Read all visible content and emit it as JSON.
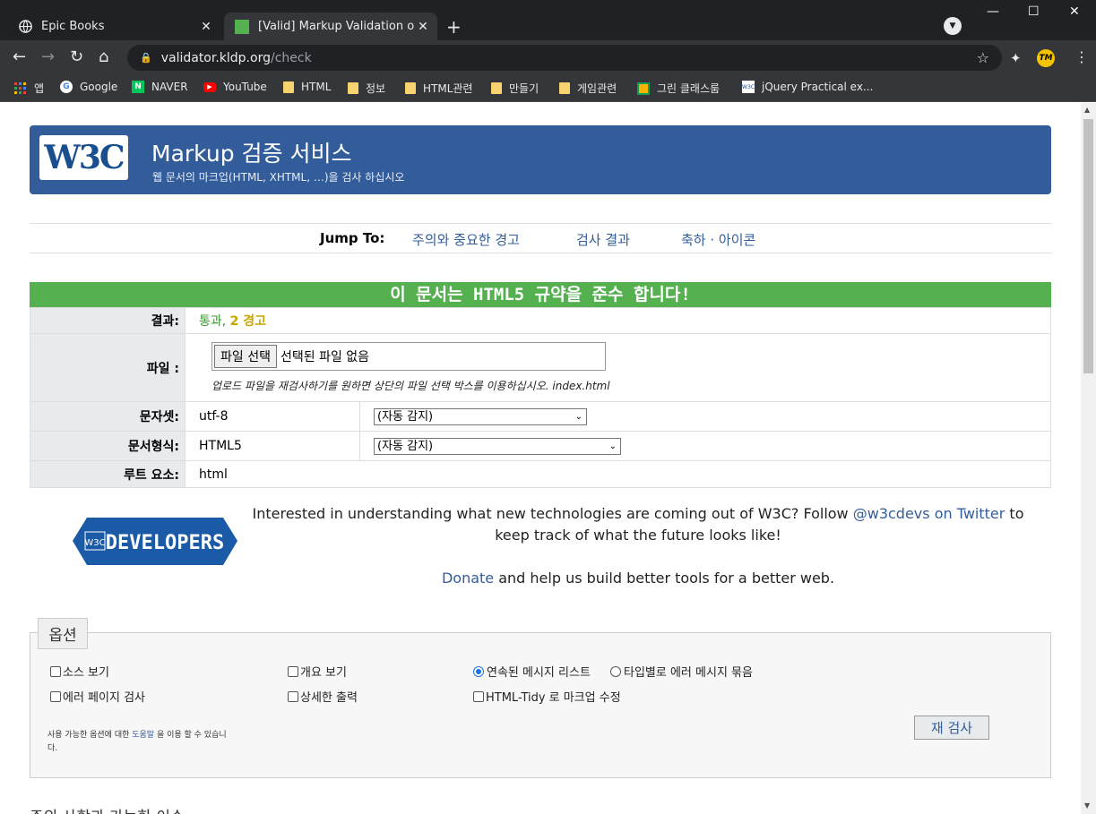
{
  "browser": {
    "tabs": [
      {
        "title": "Epic Books",
        "active": false
      },
      {
        "title": "[Valid] Markup Validation of ind",
        "active": true
      }
    ],
    "url_host": "validator.kldp.org",
    "url_path": "/check",
    "bookmarks": [
      {
        "label": "앱",
        "icon": "apps-grid-icon"
      },
      {
        "label": "Google",
        "icon": "google-icon"
      },
      {
        "label": "NAVER",
        "icon": "naver-icon"
      },
      {
        "label": "YouTube",
        "icon": "youtube-icon"
      },
      {
        "label": "HTML",
        "icon": "folder-icon"
      },
      {
        "label": "정보",
        "icon": "folder-icon"
      },
      {
        "label": "HTML관련",
        "icon": "folder-icon"
      },
      {
        "label": "만들기",
        "icon": "folder-icon"
      },
      {
        "label": "게임관련",
        "icon": "folder-icon"
      },
      {
        "label": "그린 클래스룸",
        "icon": "classroom-icon"
      },
      {
        "label": "jQuery Practical ex...",
        "icon": "w3c-icon"
      }
    ]
  },
  "banner": {
    "logo_text": "W3C",
    "title": "Markup 검증 서비스",
    "subtitle": "웹 문서의 마크업(HTML, XHTML, …)을 검사 하십시오"
  },
  "jump": {
    "label": "Jump To:",
    "links": [
      "주의와 중요한 경고",
      "검사 결과",
      "축하 · 아이콘"
    ]
  },
  "result": {
    "header": "이 문서는 HTML5 규약을 준수 합니다!",
    "rows": {
      "result_label": "결과:",
      "result_pass": "통과,",
      "result_warn": "2 경고",
      "file_label": "파일 :",
      "file_button": "파일 선택",
      "file_none": "선택된 파일 없음",
      "file_hint": "업로드 파일을 재검사하기를 원하면 상단의 파일 선택 박스를 이용하십시오. index.html",
      "charset_label": "문자셋:",
      "charset_value": "utf-8",
      "charset_select": "(자동 감지)",
      "doctype_label": "문서형식:",
      "doctype_value": "HTML5",
      "doctype_select": "(자동 감지)",
      "root_label": "루트 요소:",
      "root_value": "html"
    }
  },
  "developers": {
    "logo_text": "DEVELOPERS",
    "logo_badge": "W3C",
    "line1_a": "Interested in understanding what new technologies are coming out of W3C? Follow ",
    "line1_link": "@w3cdevs on Twitter",
    "line1_b": " to keep track of what the future looks like!",
    "donate_link": "Donate",
    "donate_rest": " and help us build better tools for a better web."
  },
  "options": {
    "legend": "옵션",
    "show_source": "소스 보기",
    "show_outline": "개요 보기",
    "sequential": "연속된 메시지 리스트",
    "group_by_type": "타입별로 에러 메시지 묶음",
    "verbose_errors": "에러 페이지 검사",
    "verbose_output": "상세한 출력",
    "tidy": "HTML-Tidy 로 마크업 수정",
    "help_a": "사용 가능한 옵션에 대한 ",
    "help_link": "도움말",
    "help_b": " 을 이용 할 수 있습니다.",
    "recheck": "재 검사"
  },
  "cutoff_heading": "주의 사항과 가능한 이슈"
}
